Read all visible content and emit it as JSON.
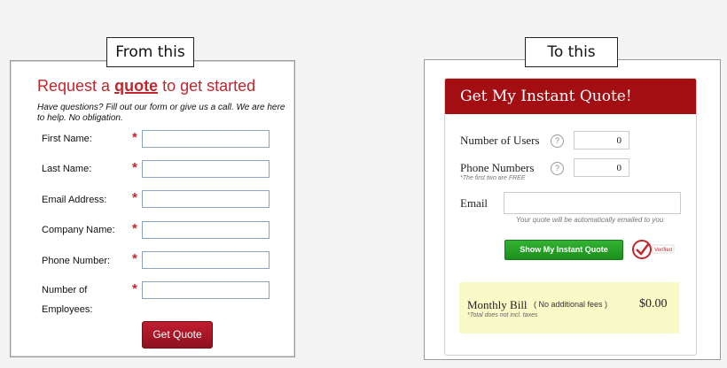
{
  "captions": {
    "left": "From this",
    "right": "To this"
  },
  "old_form": {
    "title_prefix": "Request a",
    "title_keyword": "quote",
    "title_suffix": "to get started",
    "intro": "Have questions? Fill out our form or give us a call. We are here to help. No obligation.",
    "required_marker": "*",
    "fields": [
      {
        "label": "First Name:",
        "label2": ""
      },
      {
        "label": "Last Name:",
        "label2": ""
      },
      {
        "label": "Email Address:",
        "label2": ""
      },
      {
        "label": "Company Name:",
        "label2": ""
      },
      {
        "label": "Phone Number:",
        "label2": ""
      },
      {
        "label": "Number of",
        "label2": "Employees:"
      }
    ],
    "submit_label": "Get Quote",
    "colors": {
      "accent": "#c0272d"
    }
  },
  "new_form": {
    "header": "Get My Instant Quote!",
    "users_label": "Number of Users",
    "users_value": "0",
    "phones_label": "Phone Numbers",
    "phones_value": "0",
    "phones_note": "*The first two are FREE",
    "help_glyph": "?",
    "email_label": "Email",
    "email_value": "",
    "email_note": "Your quote will be automatically emailed to you",
    "submit_label": "Show My Instant Quote",
    "badge_text": "Verified",
    "bill_label": "Monthly Bill",
    "bill_fees": "( No additional fees )",
    "bill_amount": "$0.00",
    "bill_note": "*Total does not incl. taxes",
    "colors": {
      "header": "#a30e12",
      "button": "#22a022",
      "bill_bg": "#fafac8"
    }
  }
}
